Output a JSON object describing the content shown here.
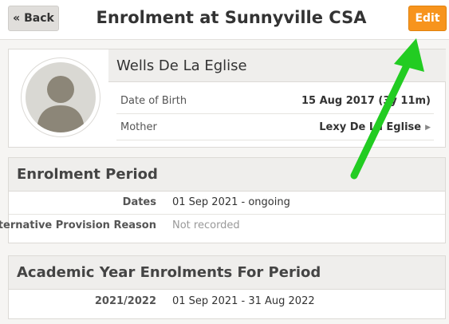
{
  "header": {
    "back_label": "« Back",
    "title": "Enrolment at Sunnyville CSA",
    "edit_label": "Edit"
  },
  "profile": {
    "name": "Wells De La Eglise",
    "fields": [
      {
        "label": "Date of Birth",
        "value": "15 Aug 2017 (3y 11m)"
      },
      {
        "label": "Mother",
        "value": "Lexy De La Eglise"
      }
    ]
  },
  "enrolment_period": {
    "title": "Enrolment Period",
    "rows": [
      {
        "label": "Dates",
        "value": "01 Sep 2021 - ongoing"
      },
      {
        "label": "Alternative Provision Reason",
        "value": "Not recorded"
      }
    ]
  },
  "academic_year": {
    "title": "Academic Year Enrolments For Period",
    "rows": [
      {
        "label": "2021/2022",
        "value": "01 Sep 2021 - 31 Aug 2022"
      }
    ]
  },
  "colors": {
    "accent": "#f7941d",
    "annotation_arrow": "#22cc22"
  },
  "icons": {
    "back": "double-left-angle",
    "avatar": "person-silhouette",
    "mother_link": "chevron-right-icon"
  }
}
